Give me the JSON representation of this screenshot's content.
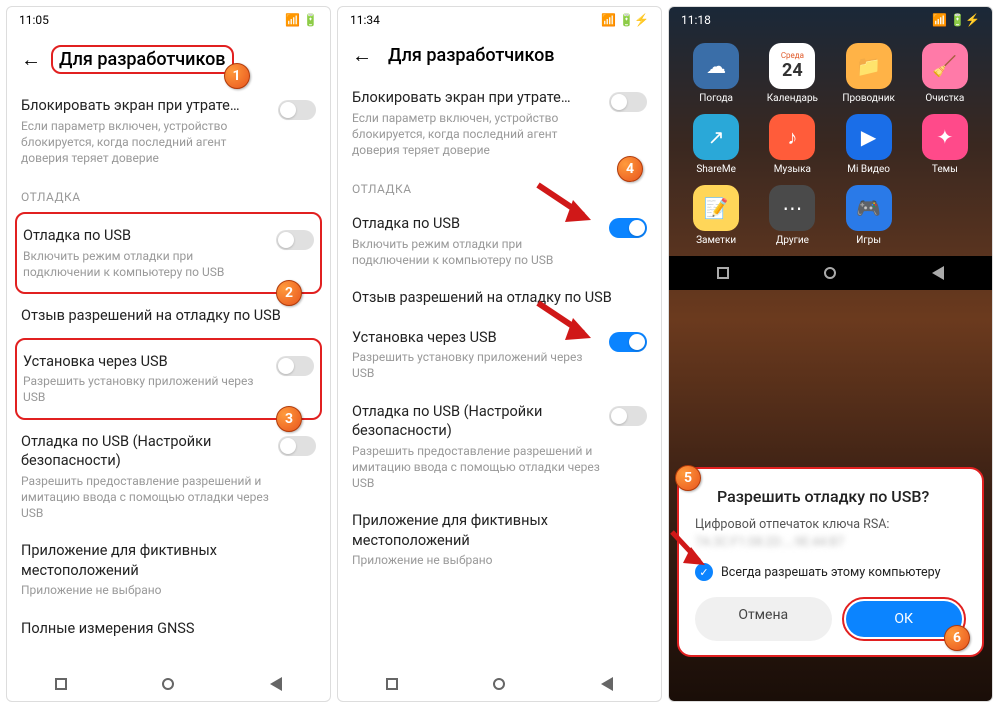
{
  "p1": {
    "time": "11:05",
    "title": "Для разработчиков",
    "lock_title": "Блокировать экран при утрате…",
    "lock_desc": "Если параметр включен, устройство блокируется, когда последний агент доверия теряет доверие",
    "section": "ОТЛАДКА",
    "usb_title": "Отладка по USB",
    "usb_desc": "Включить режим отладки при подключении к компьютеру по USB",
    "revoke_title": "Отзыв разрешений на отладку по USB",
    "install_title": "Установка через USB",
    "install_desc": "Разрешить установку приложений через USB",
    "sec_title": "Отладка по USB (Настройки безопасности)",
    "sec_desc": "Разрешить предоставление разрешений и имитацию ввода с помощью отладки через USB",
    "mock_title": "Приложение для фиктивных местоположений",
    "mock_desc": "Приложение не выбрано",
    "gnss_title": "Полные измерения GNSS"
  },
  "p2": {
    "time": "11:34",
    "title": "Для разработчиков",
    "lock_title": "Блокировать экран при утрате…",
    "lock_desc": "Если параметр включен, устройство блокируется, когда последний агент доверия теряет доверие",
    "section": "ОТЛАДКА",
    "usb_title": "Отладка по USB",
    "usb_desc": "Включить режим отладки при подключении к компьютеру по USB",
    "revoke_title": "Отзыв разрешений на отладку по USB",
    "install_title": "Установка через USB",
    "install_desc": "Разрешить установку приложений через USB",
    "sec_title": "Отладка по USB (Настройки безопасности)",
    "sec_desc": "Разрешить предоставление разрешений и имитацию ввода с помощью отладки через USB",
    "mock_title": "Приложение для фиктивных местоположений",
    "mock_desc": "Приложение не выбрано"
  },
  "p3": {
    "time": "11:18",
    "apps": [
      {
        "name": "Погода",
        "color": "#3a6ea8",
        "glyph": "☁"
      },
      {
        "name": "Календарь",
        "color": "#ffffff",
        "glyph": "24",
        "sub": "Среда"
      },
      {
        "name": "Проводник",
        "color": "#ffb347",
        "glyph": "📁"
      },
      {
        "name": "Очистка",
        "color": "#ff7aa8",
        "glyph": "🧹"
      },
      {
        "name": "ShareMe",
        "color": "#2aa8d8",
        "glyph": "↗"
      },
      {
        "name": "Музыка",
        "color": "#ff5c3a",
        "glyph": "♪"
      },
      {
        "name": "Mi Видео",
        "color": "#1a6ee8",
        "glyph": "▶"
      },
      {
        "name": "Темы",
        "color": "#ff4a8a",
        "glyph": "✦"
      },
      {
        "name": "Заметки",
        "color": "#ffd659",
        "glyph": "📝"
      },
      {
        "name": "Другие",
        "color": "#4a4a4a",
        "glyph": "⋯"
      },
      {
        "name": "Игры",
        "color": "#2a7ae8",
        "glyph": "🎮"
      }
    ],
    "dialog": {
      "title": "Разрешить отладку по USB?",
      "fingerprint_label": "Цифровой отпечаток ключа RSA:",
      "fingerprint": "7A:3C:F1:08:2D:…:9E:44:B7",
      "always": "Всегда разрешать этому компьютеру",
      "cancel": "Отмена",
      "ok": "ОК"
    }
  },
  "badges": {
    "b1": "1",
    "b2": "2",
    "b3": "3",
    "b4": "4",
    "b5": "5",
    "b6": "6"
  }
}
